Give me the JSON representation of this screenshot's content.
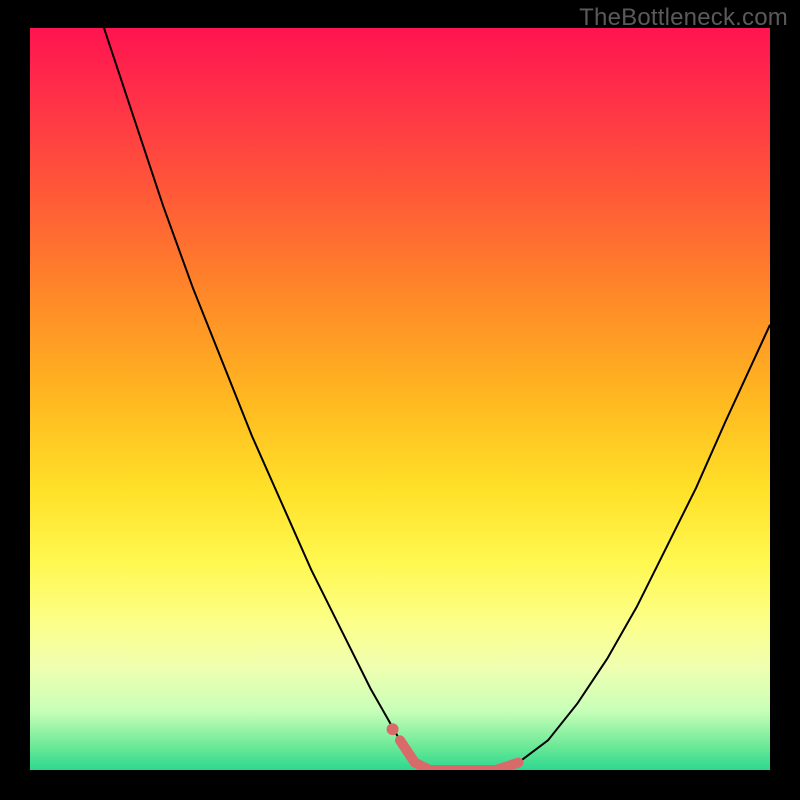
{
  "watermark": "TheBottleneck.com",
  "chart_data": {
    "type": "line",
    "title": "",
    "xlabel": "",
    "ylabel": "",
    "xlim": [
      0,
      100
    ],
    "ylim": [
      0,
      100
    ],
    "grid": false,
    "background_gradient": {
      "top": "#ff1450",
      "mid": "#ffe028",
      "bottom": "#2cd890"
    },
    "series": [
      {
        "name": "bottleneck-curve",
        "color": "#000000",
        "stroke_width": 2,
        "x": [
          10,
          14,
          18,
          22,
          26,
          30,
          34,
          38,
          42,
          46,
          50,
          52,
          54,
          57,
          60,
          63,
          66,
          70,
          74,
          78,
          82,
          86,
          90,
          94,
          100
        ],
        "values": [
          100,
          88,
          76,
          65,
          55,
          45,
          36,
          27,
          19,
          11,
          4,
          1,
          0,
          0,
          0,
          0,
          1,
          4,
          9,
          15,
          22,
          30,
          38,
          47,
          60
        ]
      },
      {
        "name": "optimal-range-marker",
        "color": "#d86a6a",
        "stroke_width": 10,
        "linecap": "round",
        "x": [
          50,
          52,
          54,
          57,
          60,
          63,
          66
        ],
        "values": [
          4,
          1,
          0,
          0,
          0,
          0,
          1
        ]
      },
      {
        "name": "optimal-range-dot",
        "type": "scatter",
        "color": "#d86a6a",
        "radius": 6,
        "x": [
          49
        ],
        "values": [
          5.5
        ]
      }
    ]
  }
}
